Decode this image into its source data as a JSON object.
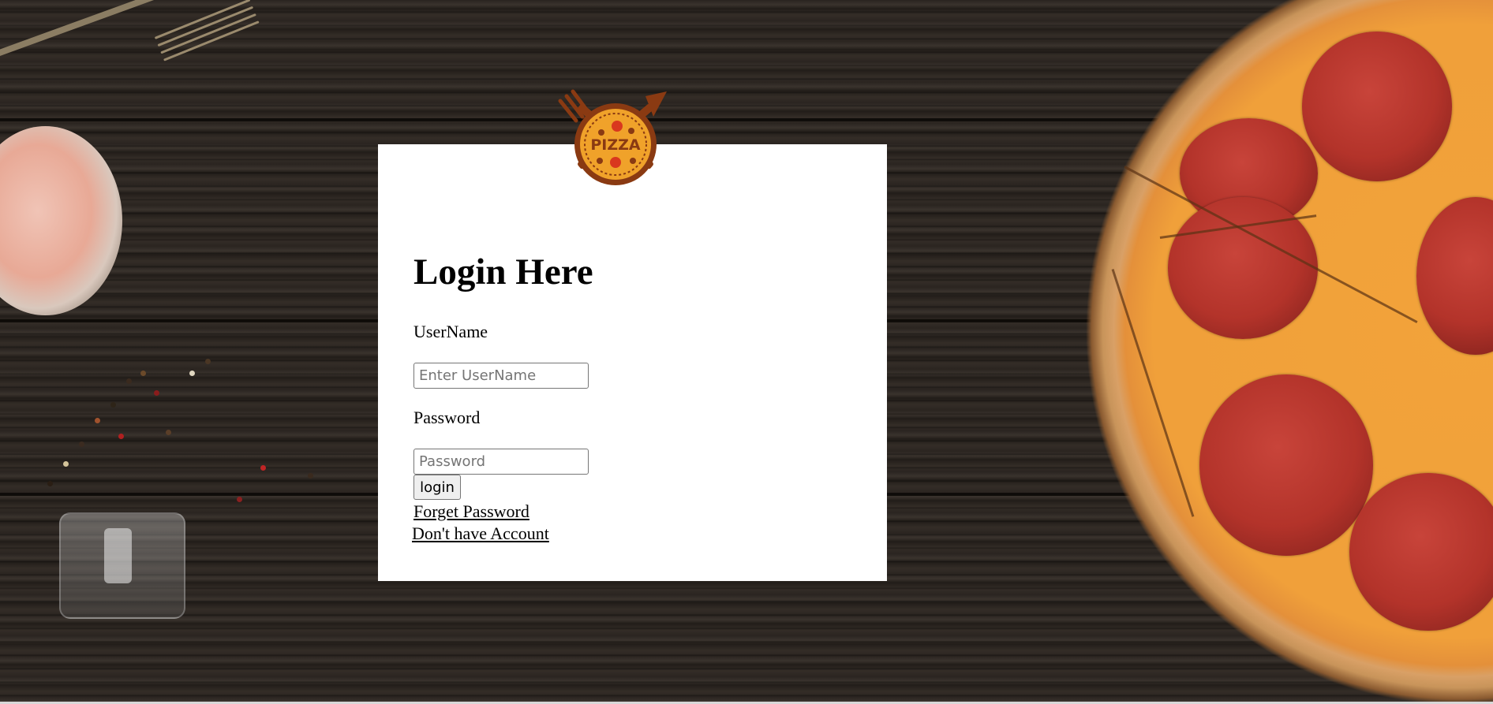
{
  "login": {
    "title": "Login Here",
    "username_label": "UserName",
    "username_placeholder": "Enter UserName",
    "username_value": "",
    "password_label": "Password",
    "password_placeholder": "Password",
    "password_value": "",
    "login_button": "login",
    "forget_password_link": "Forget Password",
    "signup_link": "Don't have Account"
  },
  "logo": {
    "text": "PIZZA",
    "icon": "pizza-logo-icon",
    "colors": {
      "ring": "#8a3a12",
      "fill": "#f0a22a",
      "topping": "#d9381e"
    }
  },
  "background": {
    "icon": "pizza-on-wooden-table-photo",
    "colors": {
      "wood": "#2c2622",
      "card": "#ffffff"
    }
  }
}
